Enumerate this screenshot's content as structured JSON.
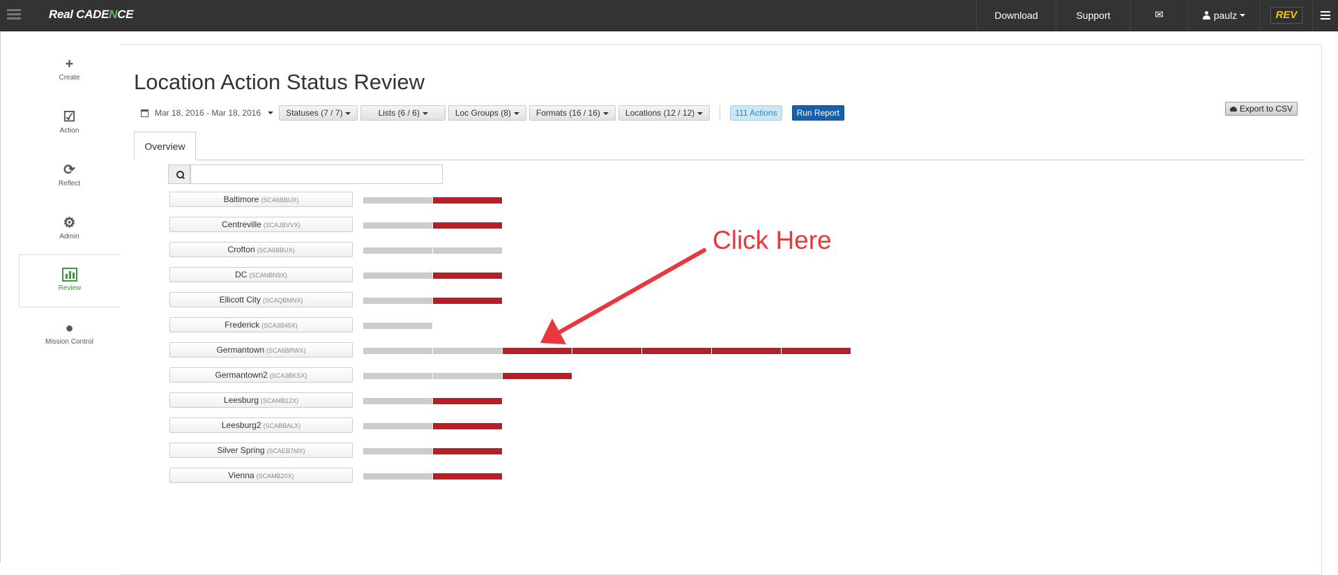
{
  "navbar": {
    "brand_prefix": "Real CADE",
    "brand_accent": "N",
    "brand_suffix": "CE",
    "download": "Download",
    "support": "Support",
    "mail_icon": "envelope-icon",
    "user": "paulz",
    "logo_text": "REV",
    "menu_icon": "hamburger-icon"
  },
  "sidebar": {
    "items": [
      {
        "label": "Create",
        "icon": "plus-icon"
      },
      {
        "label": "Action",
        "icon": "checkbox-icon"
      },
      {
        "label": "Reflect",
        "icon": "refresh-icon"
      },
      {
        "label": "Admin",
        "icon": "gears-icon"
      },
      {
        "label": "Review",
        "icon": "bar-chart-icon",
        "active": true
      },
      {
        "label": "Mission Control",
        "icon": "globe-icon"
      }
    ]
  },
  "main": {
    "title": "Location Action Status Review",
    "date_range": "Mar 18, 2016 - Mar 18, 2016",
    "filters": [
      "Statuses (7 / 7)",
      "Lists (6 / 6)",
      "Loc Groups (8)",
      "Formats (16 / 16)",
      "Locations (12 / 12)"
    ],
    "actions_badge": "111 Actions",
    "run_report": "Run Report",
    "export": "Export to CSV",
    "tab": "Overview",
    "search_value": ""
  },
  "colors": {
    "navbar": "#333333",
    "bar_gray": "#cccccc",
    "bar_red": "#b81e25",
    "active_green": "#3c9a3c",
    "annotation_red": "#e8383d",
    "run_button": "#1a5fa8"
  },
  "locations": [
    {
      "name": "Baltimore",
      "code": "(SCA6BBUX)",
      "gray": 1,
      "red": 1
    },
    {
      "name": "Centreville",
      "code": "(SCAJBVVX)",
      "gray": 1,
      "red": 1
    },
    {
      "name": "Crofton",
      "code": "(SCA6BBUX)",
      "gray": 2,
      "red": 0
    },
    {
      "name": "DC",
      "code": "(SCANBN9X)",
      "gray": 1,
      "red": 1
    },
    {
      "name": "Ellicott City",
      "code": "(SCAQBMNX)",
      "gray": 1,
      "red": 1
    },
    {
      "name": "Frederick",
      "code": "(SCA3B45X)",
      "gray": 1,
      "red": 0
    },
    {
      "name": "Germantown",
      "code": "(SCA6BRWX)",
      "gray": 2,
      "red": 5
    },
    {
      "name": "Germantown2",
      "code": "(SCA3BKSX)",
      "gray": 2,
      "red": 1
    },
    {
      "name": "Leesburg",
      "code": "(SCAMB12X)",
      "gray": 1,
      "red": 1
    },
    {
      "name": "Leesburg2",
      "code": "(SCABBALX)",
      "gray": 1,
      "red": 1
    },
    {
      "name": "Silver Spring",
      "code": "(SCAEB7MX)",
      "gray": 1,
      "red": 1
    },
    {
      "name": "Vienna",
      "code": "(SCAMB20X)",
      "gray": 1,
      "red": 1
    }
  ],
  "annotation": {
    "text": "Click Here"
  }
}
